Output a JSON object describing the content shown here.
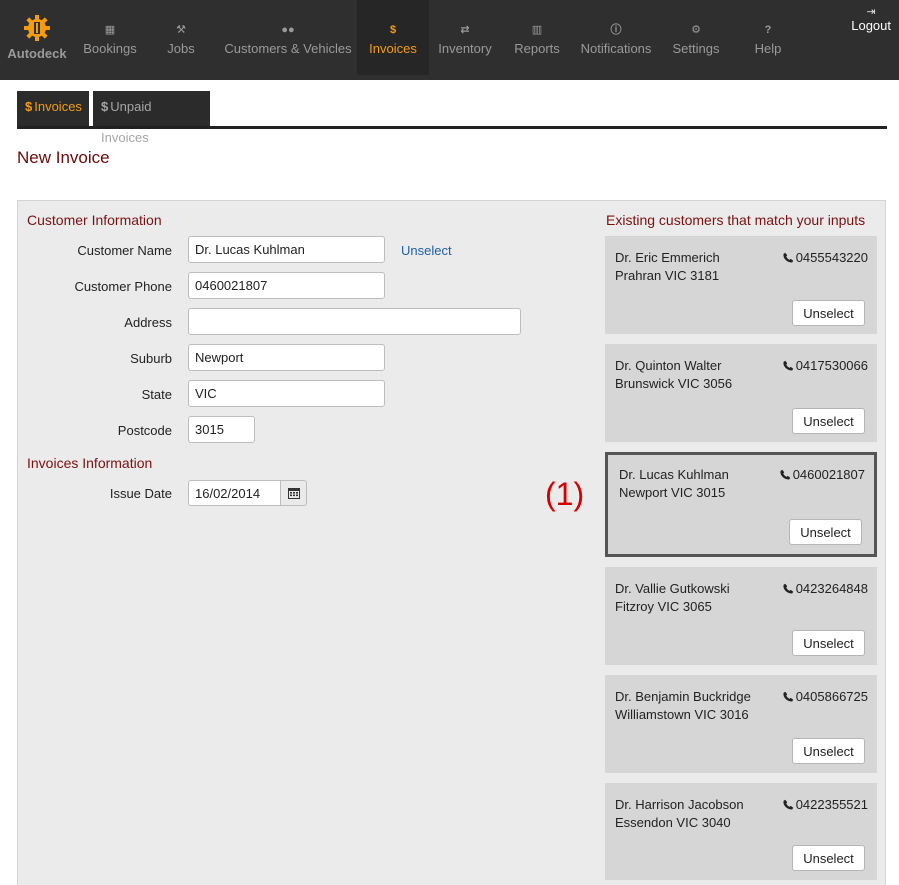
{
  "nav": {
    "brand": "Autodeck",
    "items": [
      {
        "label": "Bookings",
        "icon": "calendar-icon",
        "glyph": "▦"
      },
      {
        "label": "Jobs",
        "icon": "wrench-icon",
        "glyph": "⚒"
      },
      {
        "label": "Customers & Vehicles",
        "icon": "users-icon",
        "glyph": "●●"
      },
      {
        "label": "Invoices",
        "icon": "dollar-icon",
        "glyph": "$"
      },
      {
        "label": "Inventory",
        "icon": "exchange-icon",
        "glyph": "⇄"
      },
      {
        "label": "Reports",
        "icon": "bar-chart-icon",
        "glyph": "▥"
      },
      {
        "label": "Notifications",
        "icon": "info-icon",
        "glyph": "ⓘ"
      },
      {
        "label": "Settings",
        "icon": "cogs-icon",
        "glyph": "⚙"
      },
      {
        "label": "Help",
        "icon": "question-icon",
        "glyph": "?"
      }
    ],
    "active": "Invoices",
    "logout": "Logout",
    "logout_glyph": "⇥"
  },
  "subtabs": [
    {
      "glyph": "$",
      "label": "Invoices"
    },
    {
      "glyph": "$",
      "label": "Unpaid Invoices"
    }
  ],
  "page_title": "New Invoice",
  "customer_info": {
    "title": "Customer Information",
    "name_label": "Customer Name",
    "name_value": "Dr. Lucas Kuhlman",
    "unselect_link": "Unselect",
    "phone_label": "Customer Phone",
    "phone_value": "0460021807",
    "address_label": "Address",
    "address_value": "",
    "suburb_label": "Suburb",
    "suburb_value": "Newport",
    "state_label": "State",
    "state_value": "VIC",
    "postcode_label": "Postcode",
    "postcode_value": "3015"
  },
  "invoice_info": {
    "title": "Invoices Information",
    "issue_date_label": "Issue Date",
    "issue_date_value": "16/02/2014"
  },
  "annotation": "(1)",
  "matches": {
    "title": "Existing customers that match your inputs",
    "button_label": "Unselect",
    "customers": [
      {
        "name": "Dr. Eric Emmerich",
        "location": "Prahran VIC 3181",
        "phone": "0455543220"
      },
      {
        "name": "Dr. Quinton Walter",
        "location": "Brunswick VIC 3056",
        "phone": "0417530066"
      },
      {
        "name": "Dr. Lucas Kuhlman",
        "location": "Newport VIC 3015",
        "phone": "0460021807",
        "selected": true
      },
      {
        "name": "Dr. Vallie Gutkowski",
        "location": "Fitzroy VIC 3065",
        "phone": "0423264848"
      },
      {
        "name": "Dr. Benjamin Buckridge",
        "location": "Williamstown VIC 3016",
        "phone": "0405866725"
      },
      {
        "name": "Dr. Harrison Jacobson",
        "location": "Essendon VIC 3040",
        "phone": "0422355521"
      }
    ]
  },
  "colors": {
    "nav_bg": "#2f2f2f",
    "accent": "#f39c12",
    "heading": "#7a1111",
    "link": "#1f5fa8",
    "annotation": "#d40000"
  }
}
